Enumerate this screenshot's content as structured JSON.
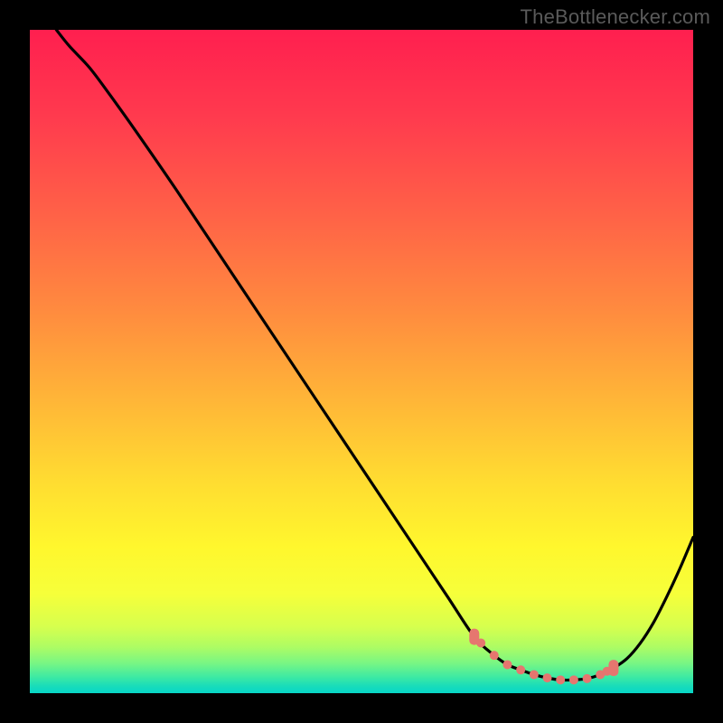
{
  "attribution": "TheBottlenecker.com",
  "colors": {
    "page_bg": "#000000",
    "attribution_text": "#5a5a5a",
    "curve_stroke": "#000000",
    "marker_fill": "#e6766f",
    "gradient_stops": [
      {
        "offset": 0.0,
        "color": "#ff1f4f"
      },
      {
        "offset": 0.13,
        "color": "#ff3a4e"
      },
      {
        "offset": 0.28,
        "color": "#ff6247"
      },
      {
        "offset": 0.42,
        "color": "#ff8a3f"
      },
      {
        "offset": 0.55,
        "color": "#ffb338"
      },
      {
        "offset": 0.68,
        "color": "#ffdc31"
      },
      {
        "offset": 0.78,
        "color": "#fff72d"
      },
      {
        "offset": 0.85,
        "color": "#f6ff3a"
      },
      {
        "offset": 0.9,
        "color": "#d6ff4e"
      },
      {
        "offset": 0.93,
        "color": "#aefc63"
      },
      {
        "offset": 0.955,
        "color": "#78f684"
      },
      {
        "offset": 0.975,
        "color": "#3feaa2"
      },
      {
        "offset": 0.99,
        "color": "#17dcbb"
      },
      {
        "offset": 1.0,
        "color": "#07d6c7"
      }
    ]
  },
  "chart_data": {
    "type": "line",
    "title": "",
    "xlabel": "",
    "ylabel": "",
    "xlim": [
      0,
      100
    ],
    "ylim": [
      0,
      100
    ],
    "x": [
      4,
      6,
      9,
      12,
      16,
      22,
      30,
      40,
      50,
      58,
      63,
      67,
      70,
      72,
      74,
      76,
      78,
      80,
      82,
      84,
      86,
      88,
      90,
      92,
      94,
      96,
      98,
      100
    ],
    "values": [
      100,
      97.5,
      94.3,
      90.3,
      84.7,
      76.0,
      64.0,
      49.0,
      34.0,
      22.0,
      14.5,
      8.5,
      5.7,
      4.3,
      3.5,
      2.8,
      2.3,
      2.0,
      2.0,
      2.2,
      2.8,
      3.8,
      5.2,
      7.5,
      10.6,
      14.5,
      18.8,
      23.5
    ],
    "optimal_region_x": [
      67,
      88
    ],
    "markers_x": [
      67,
      68,
      70,
      72,
      74,
      76,
      78,
      80,
      82,
      84,
      86,
      87,
      88
    ]
  }
}
